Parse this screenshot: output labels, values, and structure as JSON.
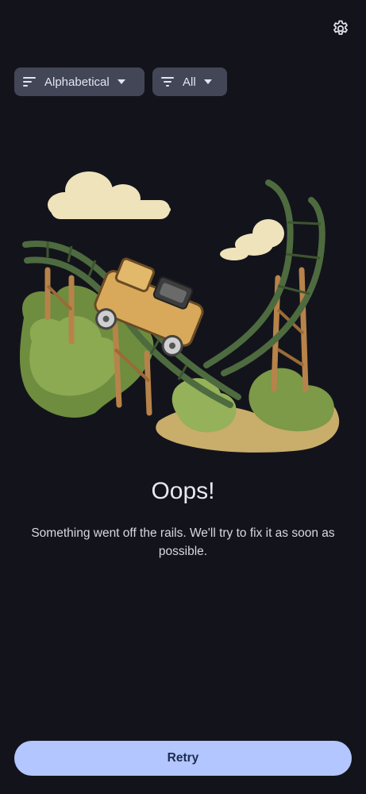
{
  "header": {
    "settings_icon": "gear-icon"
  },
  "filters": {
    "sort": {
      "label": "Alphabetical",
      "icon": "sort-lines-icon",
      "trailing_icon": "dropdown-arrow-icon"
    },
    "filter": {
      "label": "All",
      "icon": "filter-lines-icon",
      "trailing_icon": "dropdown-arrow-icon"
    }
  },
  "error": {
    "illustration": "broken-roller-coaster-illustration",
    "title": "Oops!",
    "message": "Something went off the rails. We'll try to fix it as soon as possible."
  },
  "actions": {
    "retry_label": "Retry"
  },
  "colors": {
    "background": "#13141b",
    "chip": "#424656",
    "primary_button": "#b3c6ff",
    "primary_button_text": "#1d2a4f"
  }
}
